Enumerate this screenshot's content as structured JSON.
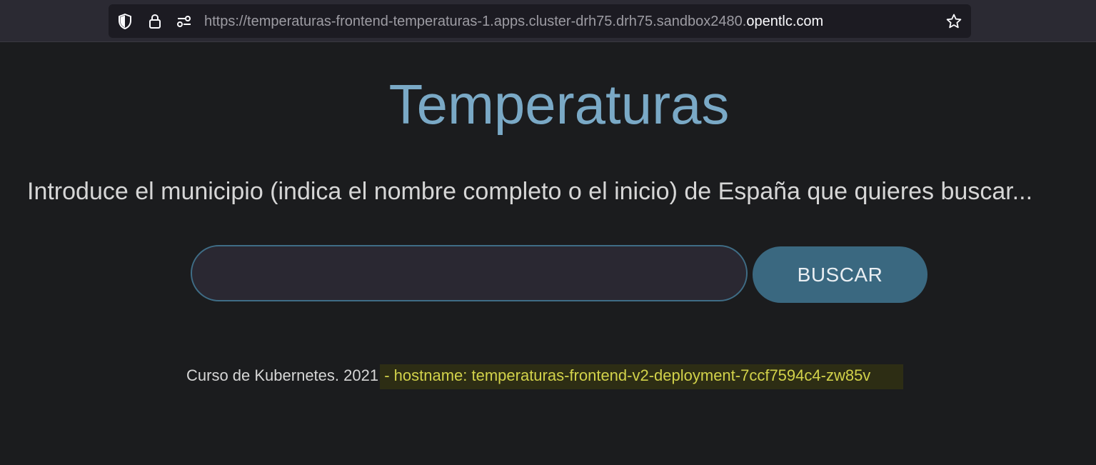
{
  "browser": {
    "url_prefix": "https://temperaturas-frontend-temperaturas-1.apps.cluster-drh75.drh75.sandbox2480.",
    "url_domain": "opentlc.com",
    "icons": [
      "shield-icon",
      "lock-icon",
      "permissions-icon",
      "star-icon"
    ]
  },
  "page": {
    "title": "Temperaturas",
    "prompt": "Introduce el municipio (indica el nombre completo o el inicio) de España que quieres buscar...",
    "search_value": "",
    "search_button_label": "BUSCAR",
    "footer_text": "Curso de Kubernetes. 2021",
    "hostname_text": "- hostname: temperaturas-frontend-v2-deployment-7ccf7594c4-zw85v"
  },
  "colors": {
    "background": "#1b1c1e",
    "title": "#7aa9c6",
    "button": "#3a6880",
    "input_border": "#3f6d86",
    "hostname": "#d2d24a"
  }
}
